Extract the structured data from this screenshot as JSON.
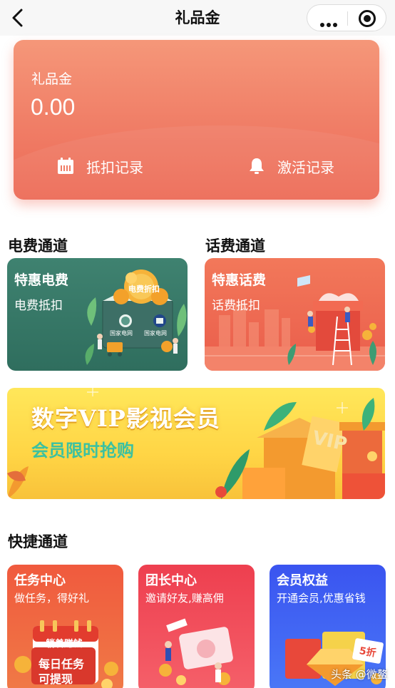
{
  "nav": {
    "title": "礼品金"
  },
  "gift_card": {
    "label": "礼品金",
    "balance": "0.00",
    "deduct_record": "抵扣记录",
    "activate_record": "激活记录"
  },
  "sections": {
    "electricity": "电费通道",
    "phone": "话费通道",
    "quick": "快捷通道"
  },
  "electricity_card": {
    "title": "特惠电费",
    "subtitle": "电费抵扣",
    "envelope_text": "电费折扣",
    "brand_left": "国家电网",
    "brand_right": "国家电网"
  },
  "phone_card": {
    "title": "特惠话费",
    "subtitle": "话费抵扣"
  },
  "vip_banner": {
    "title": "数字VIP影视会员",
    "subtitle": "会员限时抢购",
    "box_text": "VIP"
  },
  "quick_cards": [
    {
      "title": "任务中心",
      "subtitle": "做任务，得好礼",
      "badge": "躺着赚钱",
      "sign_line1": "每日任务",
      "sign_line2": "可提现"
    },
    {
      "title": "团长中心",
      "subtitle": "邀请好友,赚高佣"
    },
    {
      "title": "会员权益",
      "subtitle": "开通会员,优惠省钱",
      "discount": "5折"
    }
  ],
  "watermark": "头条 @微鳌"
}
